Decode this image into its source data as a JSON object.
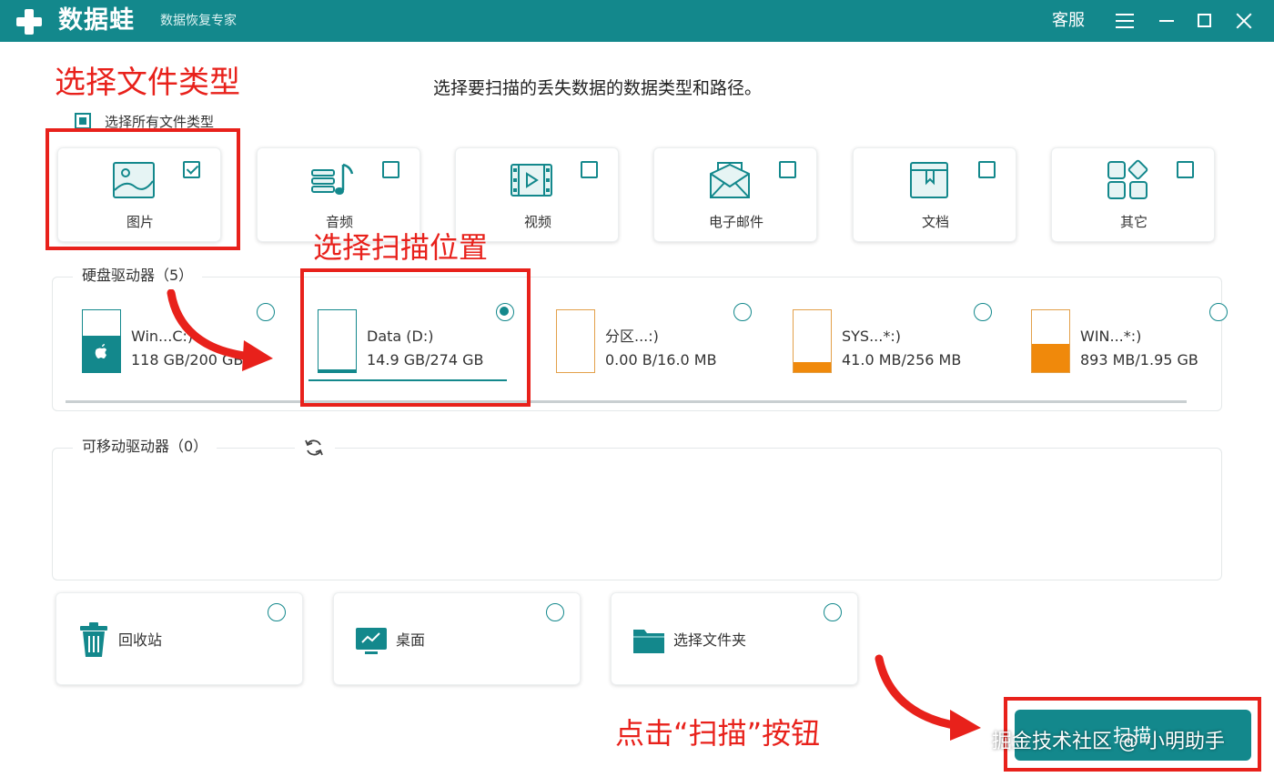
{
  "app": {
    "name": "数据蛙",
    "subtitle": "数据恢复专家",
    "service_label": "客服"
  },
  "annotations": {
    "select_type": "选择文件类型",
    "select_location": "选择扫描位置",
    "click_scan": "点击“扫描”按钮"
  },
  "instruction": "选择要扫描的丢失数据的数据类型和路径。",
  "select_all_label": "选择所有文件类型",
  "file_types": [
    {
      "label": "图片",
      "icon": "image-icon",
      "checked": true
    },
    {
      "label": "音频",
      "icon": "audio-icon",
      "checked": false
    },
    {
      "label": "视频",
      "icon": "video-icon",
      "checked": false
    },
    {
      "label": "电子邮件",
      "icon": "email-icon",
      "checked": false
    },
    {
      "label": "文档",
      "icon": "document-icon",
      "checked": false
    },
    {
      "label": "其它",
      "icon": "other-icon",
      "checked": false
    }
  ],
  "hard_drives": {
    "title": "硬盘驱动器（5）",
    "drives": [
      {
        "name": "Win...C:)",
        "size": "118 GB/200 GB",
        "fill": 0.59,
        "fill_color": "#13888c",
        "border_color": "#13888c",
        "selected": false,
        "icon": "windows-drive-icon"
      },
      {
        "name": "Data (D:)",
        "size": "14.9 GB/274 GB",
        "fill": 0.05,
        "fill_color": "#13888c",
        "border_color": "#13888c",
        "selected": true,
        "icon": "drive-icon"
      },
      {
        "name": "分区...:)",
        "size": "0.00  B/16.0 MB",
        "fill": 0,
        "fill_color": "#f0890b",
        "border_color": "#e3a04a",
        "selected": false,
        "icon": "drive-icon"
      },
      {
        "name": "SYS...*:)",
        "size": "41.0 MB/256 MB",
        "fill": 0.16,
        "fill_color": "#f0890b",
        "border_color": "#e3a04a",
        "selected": false,
        "icon": "drive-icon"
      },
      {
        "name": "WIN...*:)",
        "size": "893 MB/1.95 GB",
        "fill": 0.46,
        "fill_color": "#f0890b",
        "border_color": "#e3a04a",
        "selected": false,
        "icon": "drive-icon"
      }
    ]
  },
  "removable_drives": {
    "title": "可移动驱动器（0）",
    "refresh_icon": "refresh-icon"
  },
  "locations": [
    {
      "label": "回收站",
      "icon": "recycle-bin-icon"
    },
    {
      "label": "桌面",
      "icon": "desktop-icon"
    },
    {
      "label": "选择文件夹",
      "icon": "folder-icon"
    }
  ],
  "scan_button": "扫描",
  "watermark": "掘金技术社区 @ 小明助手",
  "colors": {
    "accent": "#13888c",
    "annotation": "#e8211b",
    "warning_fill": "#f0890b"
  }
}
